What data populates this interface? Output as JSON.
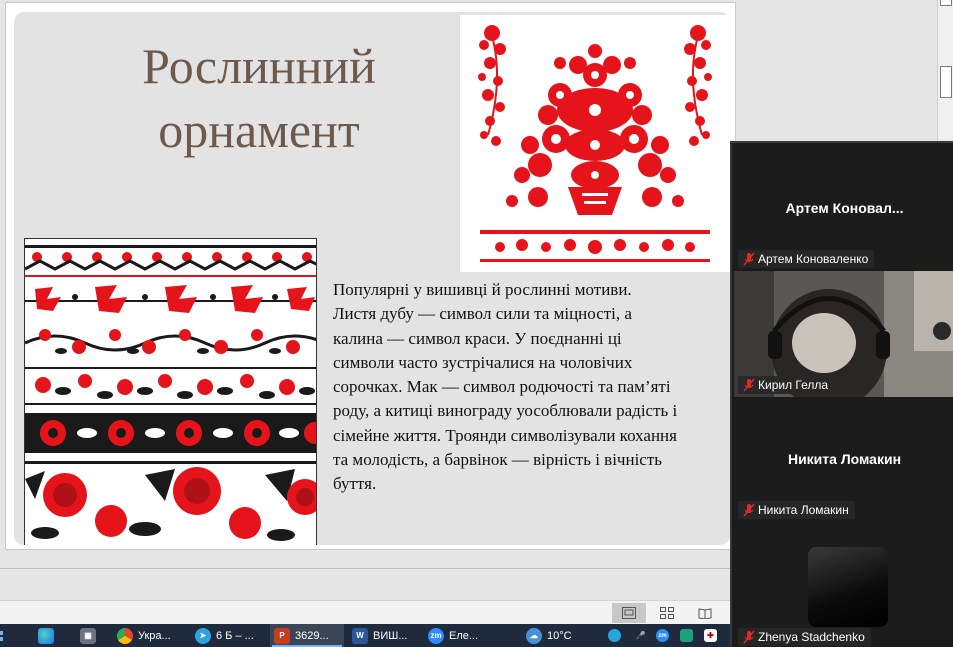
{
  "slide": {
    "title_line1": "Рослинний",
    "title_line2": "орнамент",
    "body": "Популярні у вишивці й рослинні мотиви. Листя дубу — символ сили та міцності, а калина — символ краси. У поєднанні ці символи часто зустрічалися на чоловічих сорочках. Мак — символ родючості та пам’яті роду, а китиці винограду уособлювали радість і сімейне життя. Троянди символізували кохання та молодість, а барвінок — вірність і вічність буття."
  },
  "zoom": {
    "participants": [
      {
        "display": "Артем  Коновал...",
        "label": "Артем Коноваленко",
        "video": false
      },
      {
        "display": "",
        "label": "Кирил Гелла",
        "video": true
      },
      {
        "display": "Никита Ломакин",
        "label": "Никита Ломакин",
        "video": false
      },
      {
        "display": "",
        "label": "Zhenya Stadchenko",
        "video": false,
        "avatar": true
      }
    ]
  },
  "taskbar": {
    "items": [
      {
        "icon": "edge-icon",
        "label": ""
      },
      {
        "icon": "calculator-icon",
        "label": ""
      },
      {
        "icon": "chrome-icon",
        "label": "Укра..."
      },
      {
        "icon": "telegram-icon",
        "label": "6 Б – ..."
      },
      {
        "icon": "powerpoint-icon",
        "label": "3629..."
      },
      {
        "icon": "word-icon",
        "label": "ВИШ..."
      },
      {
        "icon": "zoom-icon",
        "label": "Еле..."
      }
    ],
    "weather": "10°C",
    "tray": [
      "telegram-tray-icon",
      "zoom-tray-icon",
      "green-app-icon",
      "defender-icon"
    ]
  },
  "colors": {
    "title": "#6d5a4c",
    "embroidery_red": "#e5141b",
    "embroidery_black": "#1a1a1a",
    "zoom_bg": "#1a1a1a",
    "taskbar": "#1f2b3d"
  }
}
